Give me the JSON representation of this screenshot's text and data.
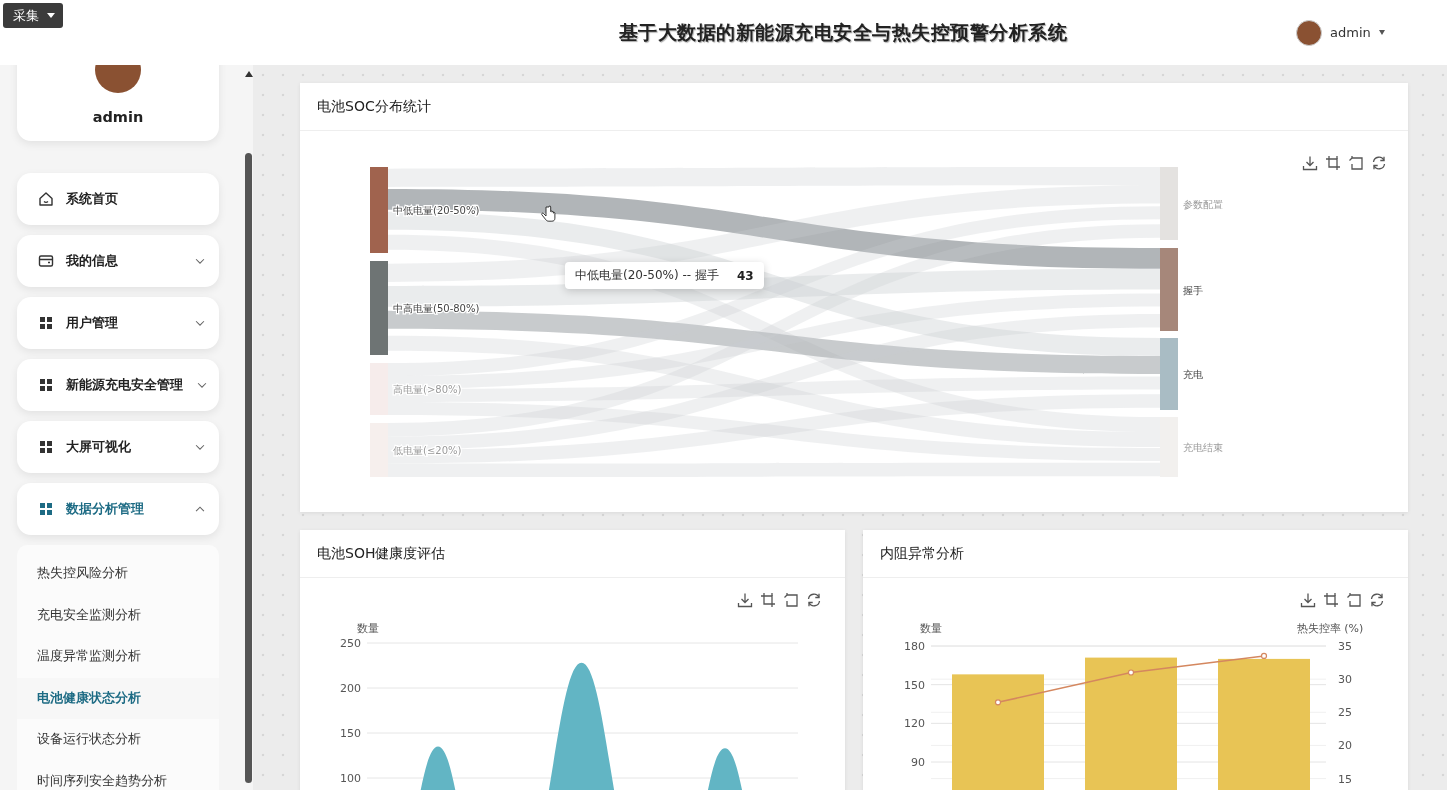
{
  "header": {
    "collect_button": "采集",
    "title": "基于大数据的新能源充电安全与热失控预警分析系统",
    "user": "admin"
  },
  "profile": {
    "name": "admin"
  },
  "menu": {
    "items": [
      {
        "label": "系统首页",
        "kind": "link",
        "selected": false
      },
      {
        "label": "我的信息",
        "kind": "group",
        "expanded": false,
        "selected": false
      },
      {
        "label": "用户管理",
        "kind": "group",
        "expanded": false,
        "selected": false
      },
      {
        "label": "新能源充电安全管理",
        "kind": "group",
        "expanded": false,
        "selected": false
      },
      {
        "label": "大屏可视化",
        "kind": "group",
        "expanded": false,
        "selected": false
      },
      {
        "label": "数据分析管理",
        "kind": "group",
        "expanded": true,
        "selected": true,
        "children": [
          {
            "label": "热失控风险分析",
            "selected": false
          },
          {
            "label": "充电安全监测分析",
            "selected": false
          },
          {
            "label": "温度异常监测分析",
            "selected": false
          },
          {
            "label": "电池健康状态分析",
            "selected": true
          },
          {
            "label": "设备运行状态分析",
            "selected": false
          },
          {
            "label": "时间序列安全趋势分析",
            "selected": false
          }
        ]
      }
    ]
  },
  "soc_card": {
    "title": "电池SOC分布统计",
    "source_nodes": [
      {
        "label": "中低电量(20-50%)",
        "color": "#a0634e",
        "faded": false
      },
      {
        "label": "中高电量(50-80%)",
        "color": "#6e7474",
        "faded": false
      },
      {
        "label": "高电量(>80%)",
        "color": "#f6eceb",
        "faded": true
      },
      {
        "label": "低电量(≤20%)",
        "color": "#f6efed",
        "faded": true
      }
    ],
    "target_nodes": [
      {
        "label": "参数配置",
        "color": "#e4e2e0",
        "faded": true
      },
      {
        "label": "握手",
        "color": "#a6877a",
        "faded": false
      },
      {
        "label": "充电",
        "color": "#a9bcc4",
        "faded": false
      },
      {
        "label": "充电结束",
        "color": "#f2f0ee",
        "faded": true
      }
    ],
    "tooltip": {
      "label": "中低电量(20-50%) -- 握手",
      "value": "43"
    }
  },
  "soh_card": {
    "title": "电池SOH健康度评估",
    "chart_data": {
      "type": "area",
      "grid": true,
      "ylabel": "数量",
      "ylim": [
        0,
        250
      ],
      "yticks": [
        100,
        150,
        200,
        250
      ],
      "series": [
        {
          "color": "#62b5c4",
          "values": [
            135,
            228,
            133
          ]
        }
      ]
    }
  },
  "ir_card": {
    "title": "内阻异常分析",
    "chart_data": {
      "type": "bar",
      "grid": true,
      "ylabel": "数量",
      "ylim": [
        0,
        180
      ],
      "yticks": [
        90,
        120,
        150,
        180
      ],
      "y2label": "热失控率 (%)",
      "y2lim": [
        0,
        35
      ],
      "y2ticks": [
        15,
        20,
        25,
        30,
        35
      ],
      "series": [
        {
          "color": "#e8c455",
          "values": [
            158,
            171,
            170
          ]
        },
        {
          "type": "line",
          "axis": "y2",
          "marker": true,
          "color": "#d4875f",
          "values": [
            26.5,
            31,
            33.5
          ]
        }
      ]
    }
  }
}
